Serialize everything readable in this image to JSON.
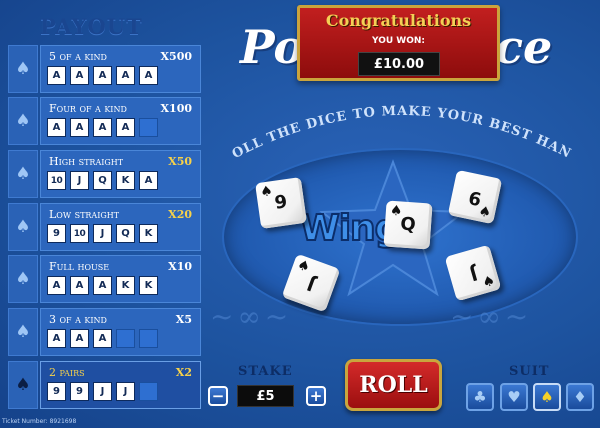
{
  "payout": {
    "title": "PAYOUT",
    "rows": [
      {
        "hand": "5 of a kind",
        "multiplier": "X500",
        "cards": [
          "A",
          "A",
          "A",
          "A",
          "A"
        ],
        "suit_icon": "spade",
        "highlight": false
      },
      {
        "hand": "Four of a kind",
        "multiplier": "X100",
        "cards": [
          "A",
          "A",
          "A",
          "A",
          ""
        ],
        "suit_icon": "spade",
        "highlight": false
      },
      {
        "hand": "High straight",
        "multiplier": "X50",
        "cards": [
          "10",
          "J",
          "Q",
          "K",
          "A"
        ],
        "suit_icon": "spade",
        "highlight": false
      },
      {
        "hand": "Low straight",
        "multiplier": "X20",
        "cards": [
          "9",
          "10",
          "J",
          "Q",
          "K"
        ],
        "suit_icon": "spade",
        "highlight": false
      },
      {
        "hand": "Full house",
        "multiplier": "X10",
        "cards": [
          "A",
          "A",
          "A",
          "K",
          "K"
        ],
        "suit_icon": "spade",
        "highlight": false
      },
      {
        "hand": "3 of a kind",
        "multiplier": "X5",
        "cards": [
          "A",
          "A",
          "A",
          "",
          ""
        ],
        "suit_icon": "spade",
        "highlight": false
      },
      {
        "hand": "2 pairs",
        "multiplier": "X2",
        "cards": [
          "9",
          "9",
          "J",
          "J",
          ""
        ],
        "suit_icon": "spade",
        "highlight": true
      }
    ]
  },
  "logo": {
    "left_text": "Po",
    "right_text": "ce"
  },
  "win_banner": {
    "title": "Congratulations",
    "subtitle": "YOU WON:",
    "amount": "£10.00"
  },
  "tagline": "ROLL THE DICE TO MAKE YOUR BEST HAND",
  "brand": "Wingo",
  "dice": [
    {
      "value": "9",
      "suit": "♠"
    },
    {
      "value": "Q",
      "suit": "♠"
    },
    {
      "value": "9",
      "suit": "♠"
    },
    {
      "value": "J",
      "suit": "♠"
    },
    {
      "value": "J",
      "suit": "♠"
    }
  ],
  "controls": {
    "stake_label": "STAKE",
    "stake_value": "£5",
    "minus": "−",
    "plus": "+",
    "roll_label": "ROLL",
    "suit_label": "SUIT",
    "suits": [
      {
        "icon": "club-icon",
        "glyph": "♣",
        "selected": false
      },
      {
        "icon": "heart-icon",
        "glyph": "♥",
        "selected": false
      },
      {
        "icon": "spade-icon",
        "glyph": "♠",
        "selected": true
      },
      {
        "icon": "diamond-icon",
        "glyph": "♦",
        "selected": false
      }
    ]
  },
  "ticket": "Ticket Number: 8921698",
  "colors": {
    "background": "#1b4f9c",
    "banner_red": "#b01818",
    "gold": "#f5cf55",
    "selected_suit": "#f5d128"
  }
}
